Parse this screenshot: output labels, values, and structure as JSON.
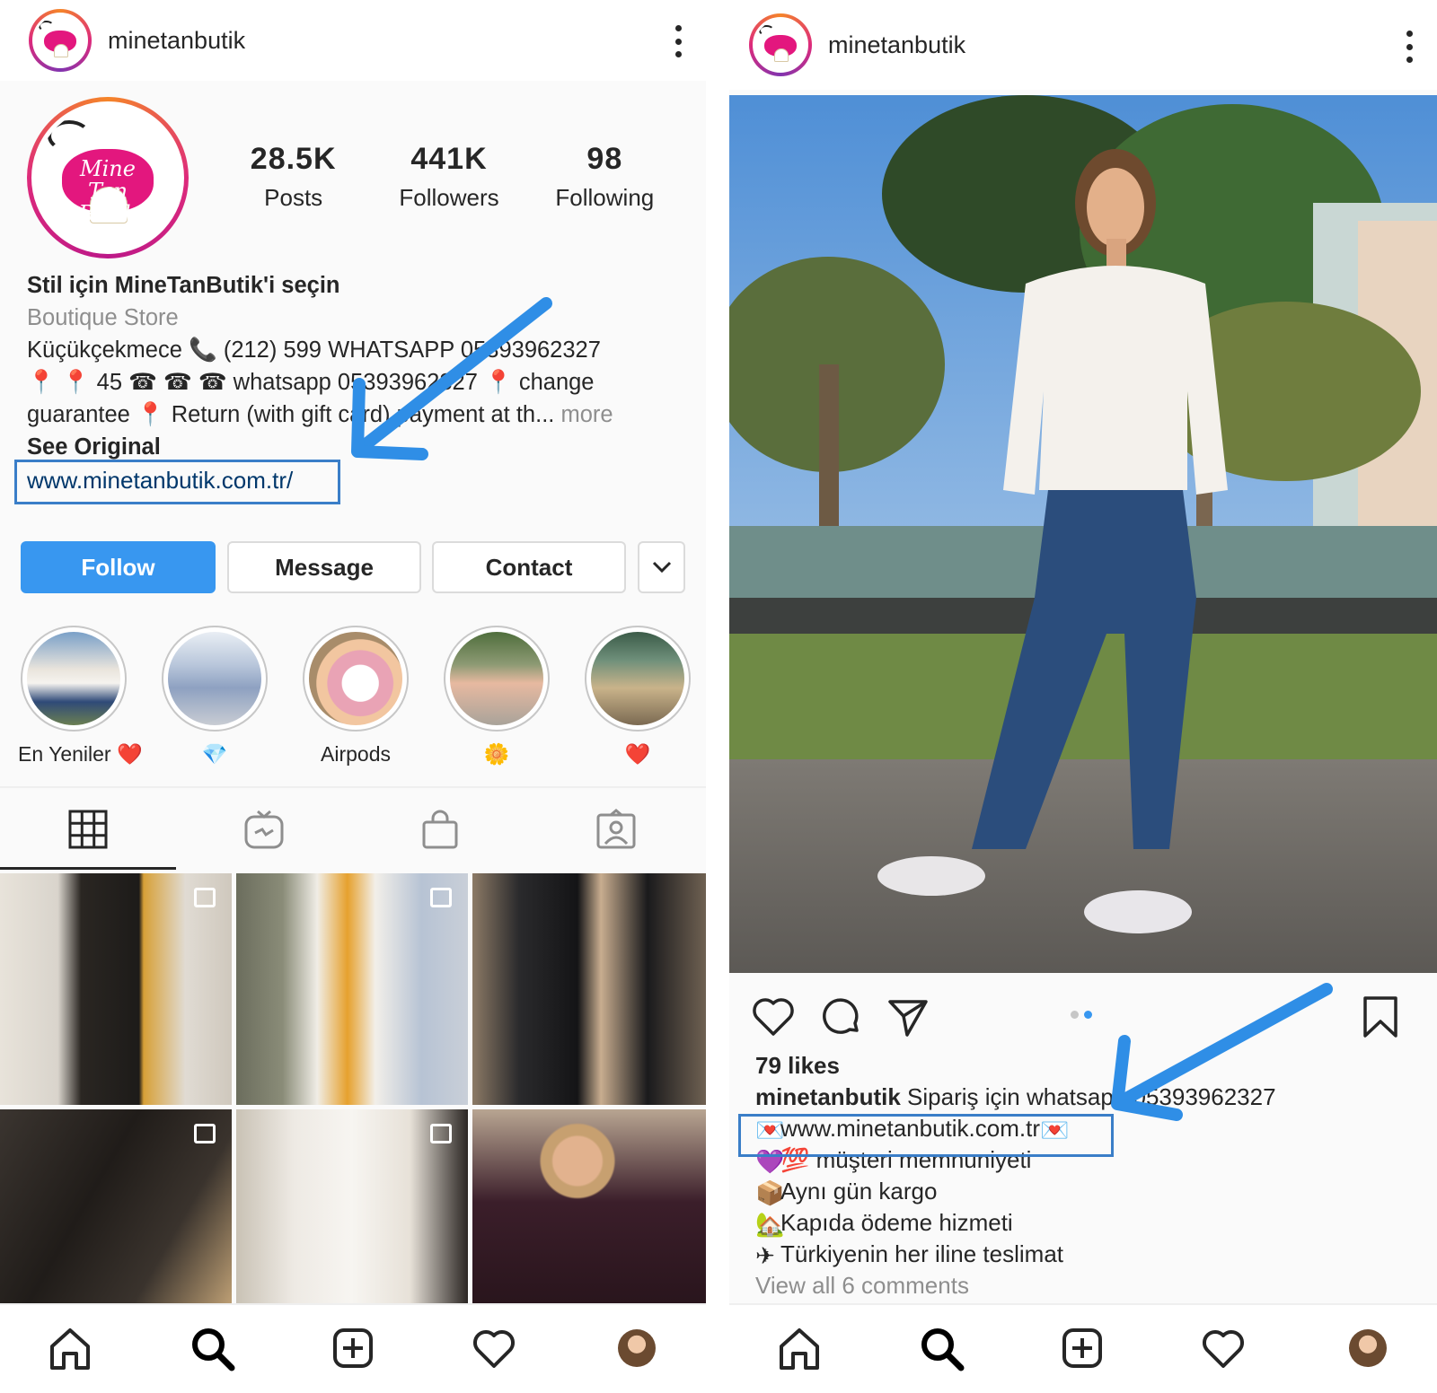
{
  "left": {
    "username": "minetanbutik",
    "logo_text_line1": "Mine Tan",
    "logo_text_line2": "Butik",
    "stats": [
      {
        "value": "28.5K",
        "label": "Posts"
      },
      {
        "value": "441K",
        "label": "Followers"
      },
      {
        "value": "98",
        "label": "Following"
      }
    ],
    "bio": {
      "name": "Stil için MineTanButik'i seçin",
      "category": "Boutique Store",
      "line1": "Küçükçekmece 📞 (212) 599 WHATSAPP 05393962327",
      "line2": "📍 📍 45 ☎ ☎ ☎ whatsapp 05393962327 📍 change",
      "line3": "guarantee 📍 Return (with gift card) payment at th...",
      "more": "more",
      "see_original": "See Original",
      "website": "www.minetanbutik.com.tr/"
    },
    "buttons": {
      "follow": "Follow",
      "message": "Message",
      "contact": "Contact"
    },
    "highlights": [
      {
        "label": "En Yeniler ❤️"
      },
      {
        "label": "💎"
      },
      {
        "label": "Airpods"
      },
      {
        "label": "🌼"
      },
      {
        "label": "❤️"
      }
    ],
    "tabs": [
      "grid-icon",
      "igtv-icon",
      "shopping-bag-icon",
      "tagged-icon"
    ]
  },
  "right": {
    "username": "minetanbutik",
    "likes": "79 likes",
    "caption_user": "minetanbutik",
    "caption_text": "Sipariş için whatsapp 05393962327",
    "lines": [
      "www.minetanbutik.com.tr",
      "💯 müşteri memnuniyeti",
      "Aynı gün kargo",
      "Kapıda ödeme hizmeti",
      "Türkiyenin her iline teslimat"
    ],
    "view_comments": "View all 6 comments"
  },
  "colors": {
    "accent_blue": "#3897f0",
    "link_blue": "#00376b",
    "highlight_box": "#3a7ec8",
    "annotation_arrow": "#2f8ee6",
    "brand_pink": "#e3177e"
  },
  "icons": {
    "bottom_nav": [
      "home-icon",
      "search-icon",
      "new-post-icon",
      "activity-heart-icon",
      "profile-avatar"
    ]
  }
}
